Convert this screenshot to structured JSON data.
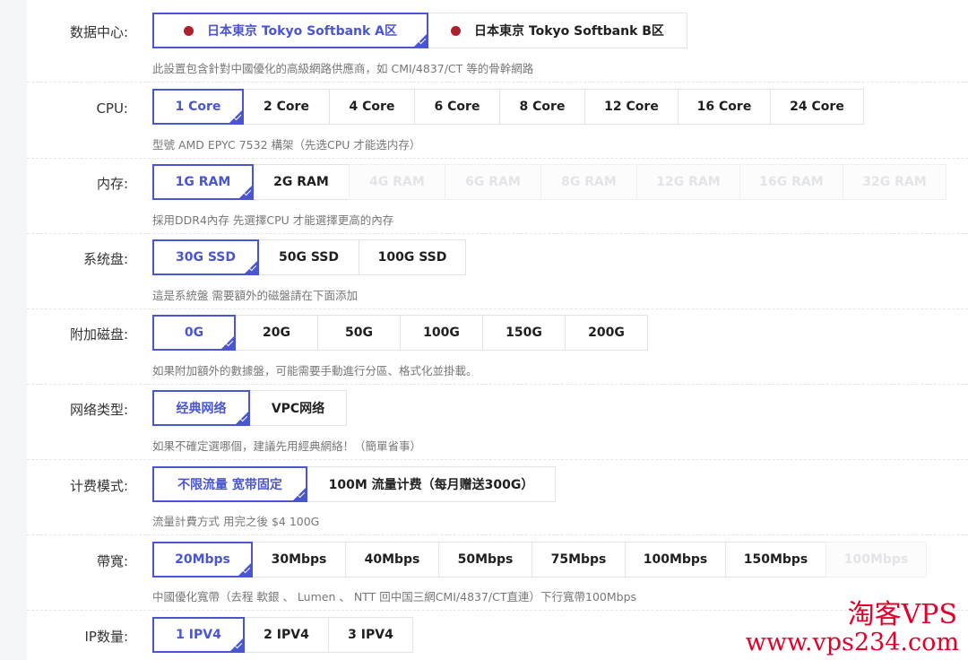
{
  "datacenter": {
    "label": "数据中心:",
    "options": [
      "日本東京 Tokyo Softbank A区",
      "日本東京 Tokyo Softbank B区"
    ],
    "selected": 0,
    "hint": "此設置包含針對中國優化的高級網路供應商，如 CMI/4837/CT 等的骨幹網路",
    "dot_color": "#b0202a"
  },
  "cpu": {
    "label": "CPU:",
    "options": [
      "1 Core",
      "2 Core",
      "4 Core",
      "6 Core",
      "8 Core",
      "12 Core",
      "16 Core",
      "24 Core"
    ],
    "selected": 0,
    "hint": "型號 AMD EPYC 7532 構架（先选CPU 才能选内存）"
  },
  "memory": {
    "label": "内存:",
    "options": [
      "1G RAM",
      "2G RAM",
      "4G RAM",
      "6G RAM",
      "8G RAM",
      "12G RAM",
      "16G RAM",
      "32G RAM"
    ],
    "selected": 0,
    "disabled_from": 2,
    "hint": "採用DDR4內存 先選擇CPU 才能選擇更高的內存"
  },
  "system_disk": {
    "label": "系统盘:",
    "options": [
      "30G SSD",
      "50G SSD",
      "100G SSD"
    ],
    "selected": 0,
    "hint": "這是系統盤 需要額外的磁盤請在下面添加"
  },
  "extra_disk": {
    "label": "附加磁盘:",
    "options": [
      "0G",
      "20G",
      "50G",
      "100G",
      "150G",
      "200G"
    ],
    "selected": 0,
    "hint": "如果附加額外的數據盤，可能需要手動進行分區、格式化並掛載。"
  },
  "network_type": {
    "label": "网络类型:",
    "options": [
      "经典网络",
      "VPC网络"
    ],
    "selected": 0,
    "hint": "如果不確定選哪個，建議先用經典網絡！（簡單省事）"
  },
  "billing": {
    "label": "计费模式:",
    "options": [
      "不限流量 宽带固定",
      "100M 流量计费（每月赠送300G）"
    ],
    "selected": 0,
    "hint": "流量計費方式 用完之後 $4 100G"
  },
  "bandwidth": {
    "label": "帶寬:",
    "options": [
      "20Mbps",
      "30Mbps",
      "40Mbps",
      "50Mbps",
      "75Mbps",
      "100Mbps",
      "150Mbps",
      "100Mbps"
    ],
    "selected": 0,
    "disabled_from": 7,
    "hint": "中國優化寬帶（去程 軟銀 、 Lumen 、 NTT 回中国三網CMI/4837/CT直連）下行寬帶100Mbps"
  },
  "ip": {
    "label": "IP数量:",
    "options": [
      "1 IPV4",
      "2 IPV4",
      "3 IPV4"
    ],
    "selected": 0
  },
  "watermark": {
    "line1": "淘客VPS",
    "line2": "www.vps234.com",
    "color": "#e0002a"
  },
  "accent_color": "#4a55d1"
}
